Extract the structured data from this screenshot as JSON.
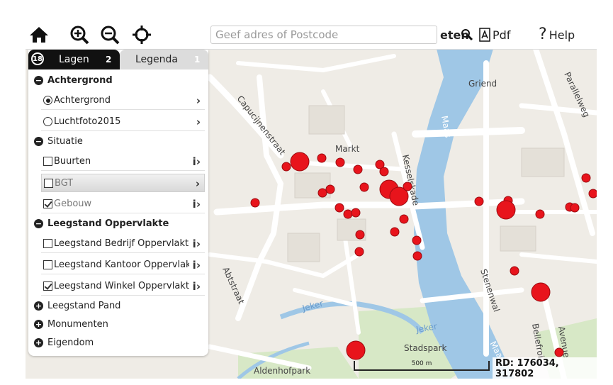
{
  "toolbar": {
    "search_placeholder": "Geef adres of Postcode",
    "measure_label": "eten",
    "pdf_label": "Pdf",
    "help_label": "Help"
  },
  "panel": {
    "layers_count": "18",
    "tab_lagen": "Lagen",
    "tab_lagen_count": "2",
    "tab_legenda": "Legenda",
    "tab_legenda_count": "1",
    "groups": [
      {
        "label": "Achtergrond",
        "expanded": true
      },
      {
        "label": "Situatie",
        "expanded": true
      },
      {
        "label": "Leegstand Oppervlakte",
        "expanded": true
      },
      {
        "label": "Leegstand Pand",
        "expanded": false
      },
      {
        "label": "Monumenten",
        "expanded": false
      },
      {
        "label": "Eigendom",
        "expanded": false
      }
    ],
    "items": [
      {
        "label": "Achtergrond",
        "control": "radio",
        "checked": true,
        "suffix": "›"
      },
      {
        "label": "Luchtfoto2015",
        "control": "radio",
        "checked": false,
        "suffix": "›"
      },
      {
        "label": "Buurten",
        "control": "checkbox",
        "checked": false,
        "suffix": "i›"
      },
      {
        "label": "BGT",
        "control": "checkbox",
        "checked": false,
        "suffix": "›"
      },
      {
        "label": "Gebouw",
        "control": "checkbox",
        "checked": true,
        "suffix": "i›"
      },
      {
        "label": "Leegstand Bedrijf Oppervlakte",
        "control": "checkbox",
        "checked": false,
        "suffix": "i›"
      },
      {
        "label": "Leegstand Kantoor Oppervlakte",
        "control": "checkbox",
        "checked": false,
        "suffix": "i›"
      },
      {
        "label": "Leegstand Winkel Oppervlakte",
        "control": "checkbox",
        "checked": true,
        "suffix": "i›"
      }
    ]
  },
  "map_labels": {
    "markt": "Markt",
    "capucijnenstraat": "Capucijnenstraat",
    "kesselskade": "Kesselskade",
    "maas1": "Maas",
    "maas2": "Maas",
    "griend": "Griend",
    "parallelweg": "Parallelweg",
    "abtstraat": "Abtstraat",
    "jeker1": "Jeker",
    "jeker2": "Jeker",
    "stadspark": "Stadspark",
    "aldenhofpark": "Aldenhofpark",
    "stenenwal": "Stenenwal",
    "bellefroid": "Bellefroi",
    "avenue": "Avenue"
  },
  "scale_bar": "500 m",
  "coordinates": "RD: 176034, 317802",
  "colors": {
    "marker_fill": "#e8141c",
    "marker_stroke": "#9b0b10",
    "water": "#9fc7e6",
    "road": "#ffffff",
    "land": "#efece6",
    "park": "#d7e8c6"
  }
}
